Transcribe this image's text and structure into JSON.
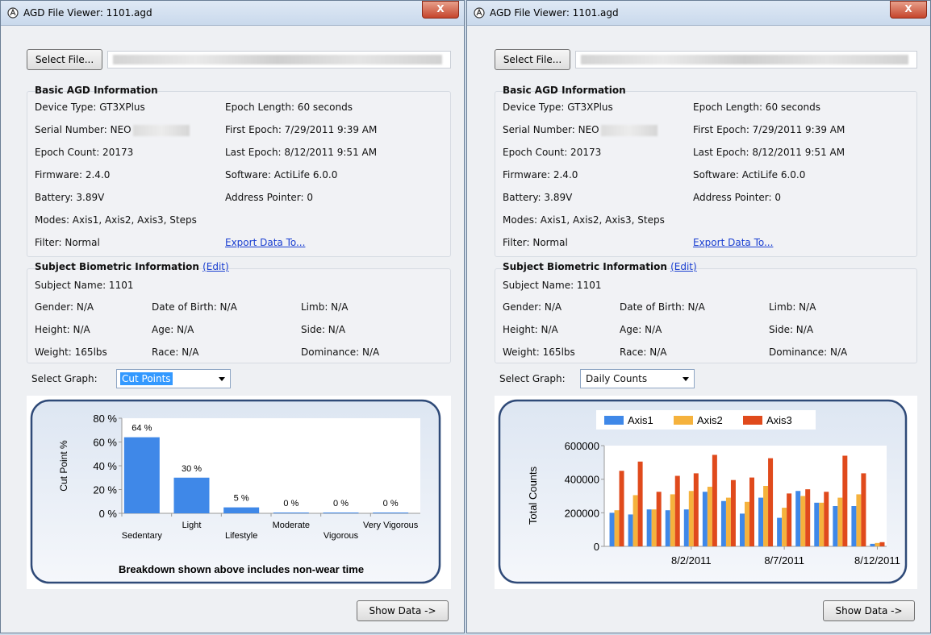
{
  "windows": [
    {
      "title": "AGD File Viewer: 1101.agd",
      "close_label": "X",
      "select_file_label": "Select File...",
      "basic": {
        "heading": "Basic AGD Information",
        "device_type": "Device Type: GT3XPlus",
        "epoch_length": "Epoch Length: 60 seconds",
        "serial_number": "Serial Number: NEO",
        "first_epoch": "First Epoch: 7/29/2011 9:39 AM",
        "epoch_count": "Epoch Count: 20173",
        "last_epoch": "Last Epoch: 8/12/2011 9:51 AM",
        "firmware": "Firmware: 2.4.0",
        "software": "Software: ActiLife 6.0.0",
        "battery": "Battery: 3.89V",
        "address_pointer": "Address Pointer: 0",
        "modes": "Modes: Axis1, Axis2, Axis3, Steps",
        "filter": "Filter: Normal",
        "export_link": "Export Data To..."
      },
      "biometric": {
        "heading": "Subject Biometric Information",
        "edit_link": "(Edit)",
        "subject_name": "Subject Name: 1101",
        "gender": "Gender: N/A",
        "dob": "Date of Birth: N/A",
        "limb": "Limb: N/A",
        "height": "Height: N/A",
        "age": "Age: N/A",
        "side": "Side: N/A",
        "weight": "Weight: 165lbs",
        "race": "Race: N/A",
        "dominance": "Dominance: N/A"
      },
      "select_graph_label": "Select Graph:",
      "select_graph_value": "Cut Points",
      "show_data_label": "Show Data ->"
    },
    {
      "title": "AGD File Viewer: 1101.agd",
      "close_label": "X",
      "select_file_label": "Select File...",
      "basic": {
        "heading": "Basic AGD Information",
        "device_type": "Device Type: GT3XPlus",
        "epoch_length": "Epoch Length: 60 seconds",
        "serial_number": "Serial Number: NEO",
        "first_epoch": "First Epoch: 7/29/2011 9:39 AM",
        "epoch_count": "Epoch Count: 20173",
        "last_epoch": "Last Epoch: 8/12/2011 9:51 AM",
        "firmware": "Firmware: 2.4.0",
        "software": "Software: ActiLife 6.0.0",
        "battery": "Battery: 3.89V",
        "address_pointer": "Address Pointer: 0",
        "modes": "Modes: Axis1, Axis2, Axis3, Steps",
        "filter": "Filter: Normal",
        "export_link": "Export Data To..."
      },
      "biometric": {
        "heading": "Subject Biometric Information",
        "edit_link": "(Edit)",
        "subject_name": "Subject Name: 1101",
        "gender": "Gender: N/A",
        "dob": "Date of Birth: N/A",
        "limb": "Limb: N/A",
        "height": "Height: N/A",
        "age": "Age: N/A",
        "side": "Side: N/A",
        "weight": "Weight: 165lbs",
        "race": "Race: N/A",
        "dominance": "Dominance: N/A"
      },
      "select_graph_label": "Select Graph:",
      "select_graph_value": "Daily Counts",
      "show_data_label": "Show Data ->"
    }
  ],
  "chart_data": [
    {
      "type": "bar",
      "categories": [
        "Sedentary",
        "Light",
        "Lifestyle",
        "Moderate",
        "Vigorous",
        "Very Vigorous"
      ],
      "values": [
        64,
        30,
        5,
        0,
        0,
        0
      ],
      "data_labels": [
        "64 %",
        "30 %",
        "5 %",
        "0 %",
        "0 %",
        "0 %"
      ],
      "ylabel": "Cut Point %",
      "yticks": [
        "0 %",
        "20 %",
        "40 %",
        "60 %",
        "80 %"
      ],
      "ylim": [
        0,
        80
      ],
      "footnote": "Breakdown shown above includes non-wear time",
      "color": "#3f88e8"
    },
    {
      "type": "bar",
      "days": 15,
      "series": [
        {
          "name": "Axis1",
          "color": "#3f88e8",
          "values": [
            200000,
            190000,
            220000,
            215000,
            220000,
            325000,
            270000,
            195000,
            290000,
            170000,
            330000,
            260000,
            240000,
            240000,
            15000
          ]
        },
        {
          "name": "Axis2",
          "color": "#f5b23d",
          "values": [
            215000,
            305000,
            220000,
            310000,
            330000,
            355000,
            290000,
            265000,
            360000,
            230000,
            300000,
            260000,
            290000,
            310000,
            20000
          ]
        },
        {
          "name": "Axis3",
          "color": "#e04a1c",
          "values": [
            450000,
            505000,
            325000,
            420000,
            435000,
            545000,
            395000,
            410000,
            525000,
            315000,
            340000,
            325000,
            540000,
            435000,
            25000
          ]
        }
      ],
      "ylabel": "Total Counts",
      "yticks": [
        "0",
        "200000",
        "400000",
        "600000"
      ],
      "ylim": [
        0,
        600000
      ],
      "xtick_labels": [
        {
          "day": 4,
          "label": "8/2/2011"
        },
        {
          "day": 9,
          "label": "8/7/2011"
        },
        {
          "day": 14,
          "label": "8/12/2011"
        }
      ],
      "legend": "top"
    }
  ]
}
